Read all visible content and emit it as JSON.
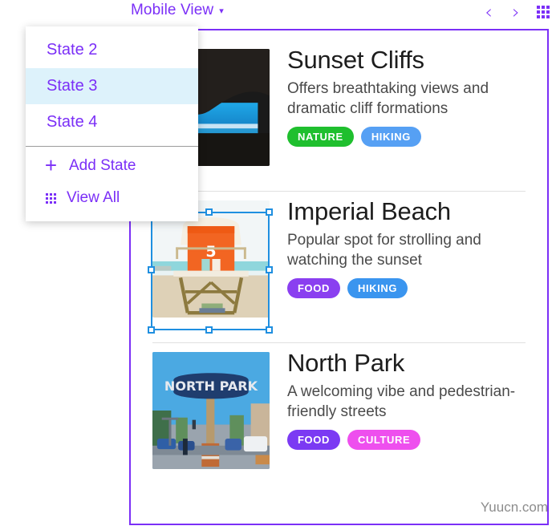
{
  "toolbar": {
    "view_selector_label": "Mobile View",
    "caret_glyph": "▾",
    "prev_glyph": "‹",
    "next_glyph": "›",
    "accent_color": "#7b2ff7"
  },
  "state_menu": {
    "items": [
      {
        "label": "State 2",
        "selected": false
      },
      {
        "label": "State 3",
        "selected": true
      },
      {
        "label": "State 4",
        "selected": false
      }
    ],
    "add_state_label": "Add State",
    "add_state_glyph": "+",
    "view_all_label": "View All",
    "highlight_color": "#ddf2fb"
  },
  "phone": {
    "cards": [
      {
        "title": "Sunset Cliffs",
        "description": "Offers breathtaking views and dramatic cliff formations",
        "image_name": "sunset-cliffs-cave-silhouette-photo",
        "selected": false,
        "tags": [
          {
            "label": "NATURE",
            "color": "#1fbf2e"
          },
          {
            "label": "HIKING",
            "color": "#56a0f4"
          }
        ]
      },
      {
        "title": "Imperial Beach",
        "description": "Popular spot for strolling and watching the sunset",
        "image_name": "imperial-beach-lifeguard-tower-photo",
        "selected": true,
        "tags": [
          {
            "label": "FOOD",
            "color": "#8a3ff0"
          },
          {
            "label": "HIKING",
            "color": "#3a95ef"
          }
        ]
      },
      {
        "title": "North Park",
        "description": "A welcoming vibe and pedestrian-friendly streets",
        "image_name": "north-park-sign-street-photo",
        "selected": false,
        "tags": [
          {
            "label": "FOOD",
            "color": "#7b3af3"
          },
          {
            "label": "CULTURE",
            "color": "#ee4fee"
          }
        ]
      }
    ],
    "frame_border_color": "#7b2ff7",
    "selection_color": "#1f8fe0"
  },
  "watermark": {
    "text": "Yuucn.com"
  }
}
